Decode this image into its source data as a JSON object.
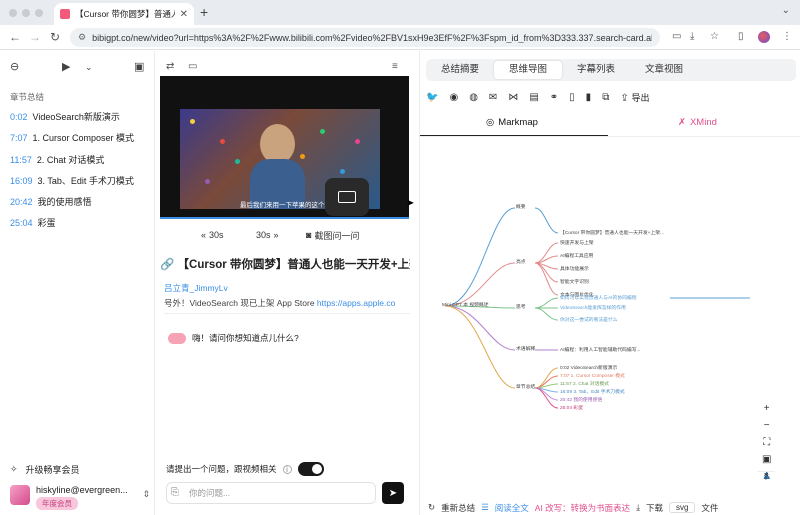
{
  "browser": {
    "tab_title": "【Cursor 带你圆梦】普通人也能",
    "tab_close": "✕",
    "new_tab": "+",
    "tab_menu": "⌄",
    "url": "bibigpt.co/new/video?url=https%3A%2F%2Fwww.bilibili.com%2Fvideo%2FBV1sxH9e3EfF%2F%3Fspm_id_from%3D333.337.search-card.all..."
  },
  "sidebar": {
    "heading": "章节总结",
    "chapters": [
      {
        "time": "0:02",
        "title": "VideoSearch新版演示"
      },
      {
        "time": "7:07",
        "title": "1. Cursor Composer 模式"
      },
      {
        "time": "11:57",
        "title": "2. Chat 对话模式"
      },
      {
        "time": "16:09",
        "title": "3. Tab、Edit 手术刀模式"
      },
      {
        "time": "20:42",
        "title": "我的使用感悟"
      },
      {
        "time": "25:04",
        "title": "彩蛋"
      }
    ],
    "upgrade_label": "升级畅享会员",
    "user_email": "hiskyline@evergreen...",
    "user_badge": "年度会员"
  },
  "video": {
    "caption": "最后我们来用一下苹果的这个效果",
    "rewind_label": "30s",
    "forward_label": "30s",
    "screenshot_label": "截图问一问"
  },
  "info": {
    "title": "【Cursor 带你圆梦】普通人也能一天开发+上架...",
    "uploader": "吕立青_JimmyLv",
    "description": "号外！VideoSearch 现已上架 App Store ",
    "description_link": "https://apps.apple.co"
  },
  "chat": {
    "greeting": "嗨！请问你想知道点儿什么?",
    "ask_label": "请提出一个问题，跟视频相关",
    "toggle_on": true,
    "input_placeholder": "你的问题..."
  },
  "right": {
    "tabs": [
      "总结摘要",
      "思维导图",
      "字幕列表",
      "文章视图"
    ],
    "active_tab": "思维导图",
    "export_label": "导出",
    "subtabs": {
      "markmap": "Markmap",
      "xmind": "XMind"
    },
    "bottom": {
      "regenerate": "重新总结",
      "fulltext": "阅读全文",
      "ai_rewrite": "AI 改写：转换为书面表达",
      "download": "下载",
      "format": "svg",
      "file": "文件"
    }
  },
  "mindmap": {
    "root": "Mini GPT 本 视频概述",
    "branches": [
      "概要",
      "亮点",
      "思考",
      "术语解释",
      "章节总结"
    ],
    "summary_text": "【Cursor 带你圆梦】普通人也能一天开发+上架...",
    "highlights": [
      "快速开发与上架",
      "AI编程工具应用",
      "具体功能展示",
      "智能文字识别",
      "文本与图片优化"
    ],
    "questions": [
      "如何可以实现普通人与AI的协同编程",
      "VideoSearch能发挥怎样的作用",
      "你对这一尝试的看法是什么"
    ],
    "term_text": "AI编程：利用人工智能辅助代码编写...",
    "chapter_nodes": [
      "0:02 VideoSearch新版演示",
      "7:07 1. Cursor Composer 模式",
      "11:57 2. Chat 对话模式",
      "16:09 3. Tab、Edit 手术刀模式",
      "20:42 我的使用感悟",
      "25:04 彩蛋"
    ]
  }
}
